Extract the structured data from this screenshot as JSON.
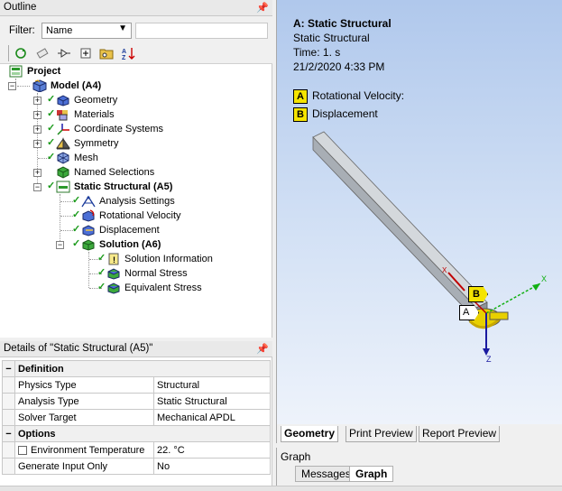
{
  "outline": {
    "title": "Outline",
    "filter_label": "Filter:",
    "filter_value": "Name",
    "filter_text": "",
    "toolbar_icons": [
      "refresh-icon",
      "eraser-icon",
      "connect-icon",
      "expand-icon",
      "folder-icon",
      "sort-icon"
    ],
    "tree": {
      "project": "Project",
      "model": "Model (A4)",
      "geometry": "Geometry",
      "materials": "Materials",
      "coordinate_systems": "Coordinate Systems",
      "symmetry": "Symmetry",
      "mesh": "Mesh",
      "named_selections": "Named Selections",
      "static_structural": "Static Structural (A5)",
      "analysis_settings": "Analysis Settings",
      "rotational_velocity": "Rotational Velocity",
      "displacement": "Displacement",
      "solution": "Solution (A6)",
      "solution_information": "Solution Information",
      "normal_stress": "Normal Stress",
      "equivalent_stress": "Equivalent Stress"
    }
  },
  "details": {
    "title": "Details of \"Static Structural (A5)\"",
    "definition_label": "Definition",
    "physics_type_label": "Physics Type",
    "physics_type_value": "Structural",
    "analysis_type_label": "Analysis Type",
    "analysis_type_value": "Static Structural",
    "solver_target_label": "Solver Target",
    "solver_target_value": "Mechanical APDL",
    "options_label": "Options",
    "env_temp_label": "Environment Temperature",
    "env_temp_value": "22. °C",
    "gen_input_label": "Generate Input Only",
    "gen_input_value": "No"
  },
  "viewport": {
    "title": "A: Static Structural",
    "subtitle": "Static Structural",
    "time": "Time: 1. s",
    "date": "21/2/2020 4:33 PM",
    "legend": [
      {
        "key": "A",
        "label": "Rotational Velocity:"
      },
      {
        "key": "B",
        "label": "Displacement"
      }
    ],
    "label_a": "A",
    "label_b": "B",
    "axis_x": "X",
    "axis_z": "Z",
    "axis_x2": "X"
  },
  "view_tabs": {
    "geometry": "Geometry",
    "print_preview": "Print Preview",
    "report_preview": "Report Preview"
  },
  "graph": {
    "title": "Graph",
    "messages": "Messages",
    "graph": "Graph"
  },
  "colors": {
    "legend_yellow": "#f5e400",
    "check_green": "#1a9a1a",
    "viewport_top": "#b0c8ec",
    "viewport_bottom": "#eef3fb"
  }
}
